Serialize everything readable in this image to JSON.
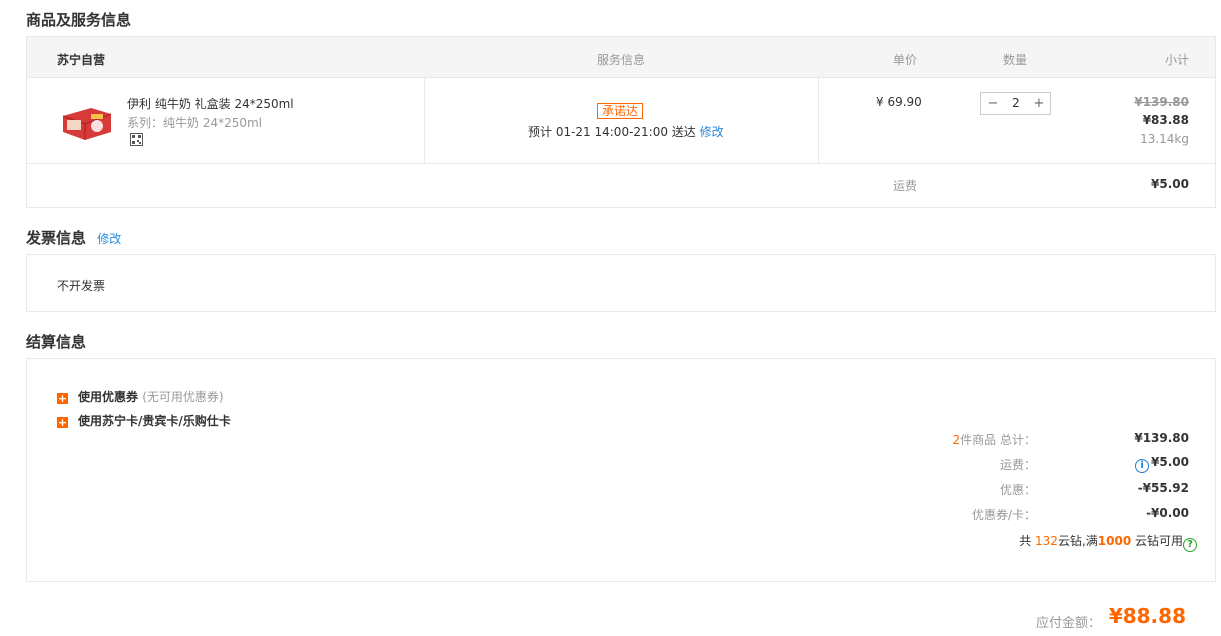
{
  "goods_section": {
    "title": "商品及服务信息",
    "header": {
      "store": "苏宁自营",
      "service": "服务信息",
      "unit_price": "单价",
      "quantity": "数量",
      "subtotal": "小计"
    },
    "item": {
      "name": "伊利 纯牛奶 礼盒装 24*250ml",
      "series": "系列：纯牛奶 24*250ml",
      "promise_badge": "承诺达",
      "eta_text": "预计 01-21 14:00-21:00  送达",
      "eta_edit": "修改",
      "unit_price": "¥ 69.90",
      "qty": "2",
      "original_subtotal": "¥139.80",
      "subtotal": "¥83.88",
      "weight": "13.14kg"
    },
    "shipping_label": "运费",
    "shipping_value": "¥5.00"
  },
  "invoice_section": {
    "title": "发票信息",
    "edit": "修改",
    "value": "不开发票"
  },
  "settlement_section": {
    "title": "结算信息",
    "coupon_option": "使用优惠券",
    "coupon_note": "(无可用优惠券)",
    "card_option": "使用苏宁卡/贵宾卡/乐购仕卡",
    "summary": {
      "count": "2",
      "count_suffix": "件商品 总计：",
      "total": "¥139.80",
      "shipping_label": "运费：",
      "shipping": "¥5.00",
      "discount_label": "优惠：",
      "discount": "-¥55.92",
      "coupon_label": "优惠券/卡：",
      "coupon": "-¥0.00"
    },
    "yunzuan": {
      "prefix": "共 ",
      "count": "132",
      "mid": "云钻,满",
      "threshold": "1000",
      "suffix": " 云钻可用"
    }
  },
  "payable": {
    "label": "应付金额：",
    "value": "¥88.88"
  },
  "colors": {
    "accent": "#ff6600",
    "link": "#2a8ad8",
    "border": "#e8e8e8"
  }
}
